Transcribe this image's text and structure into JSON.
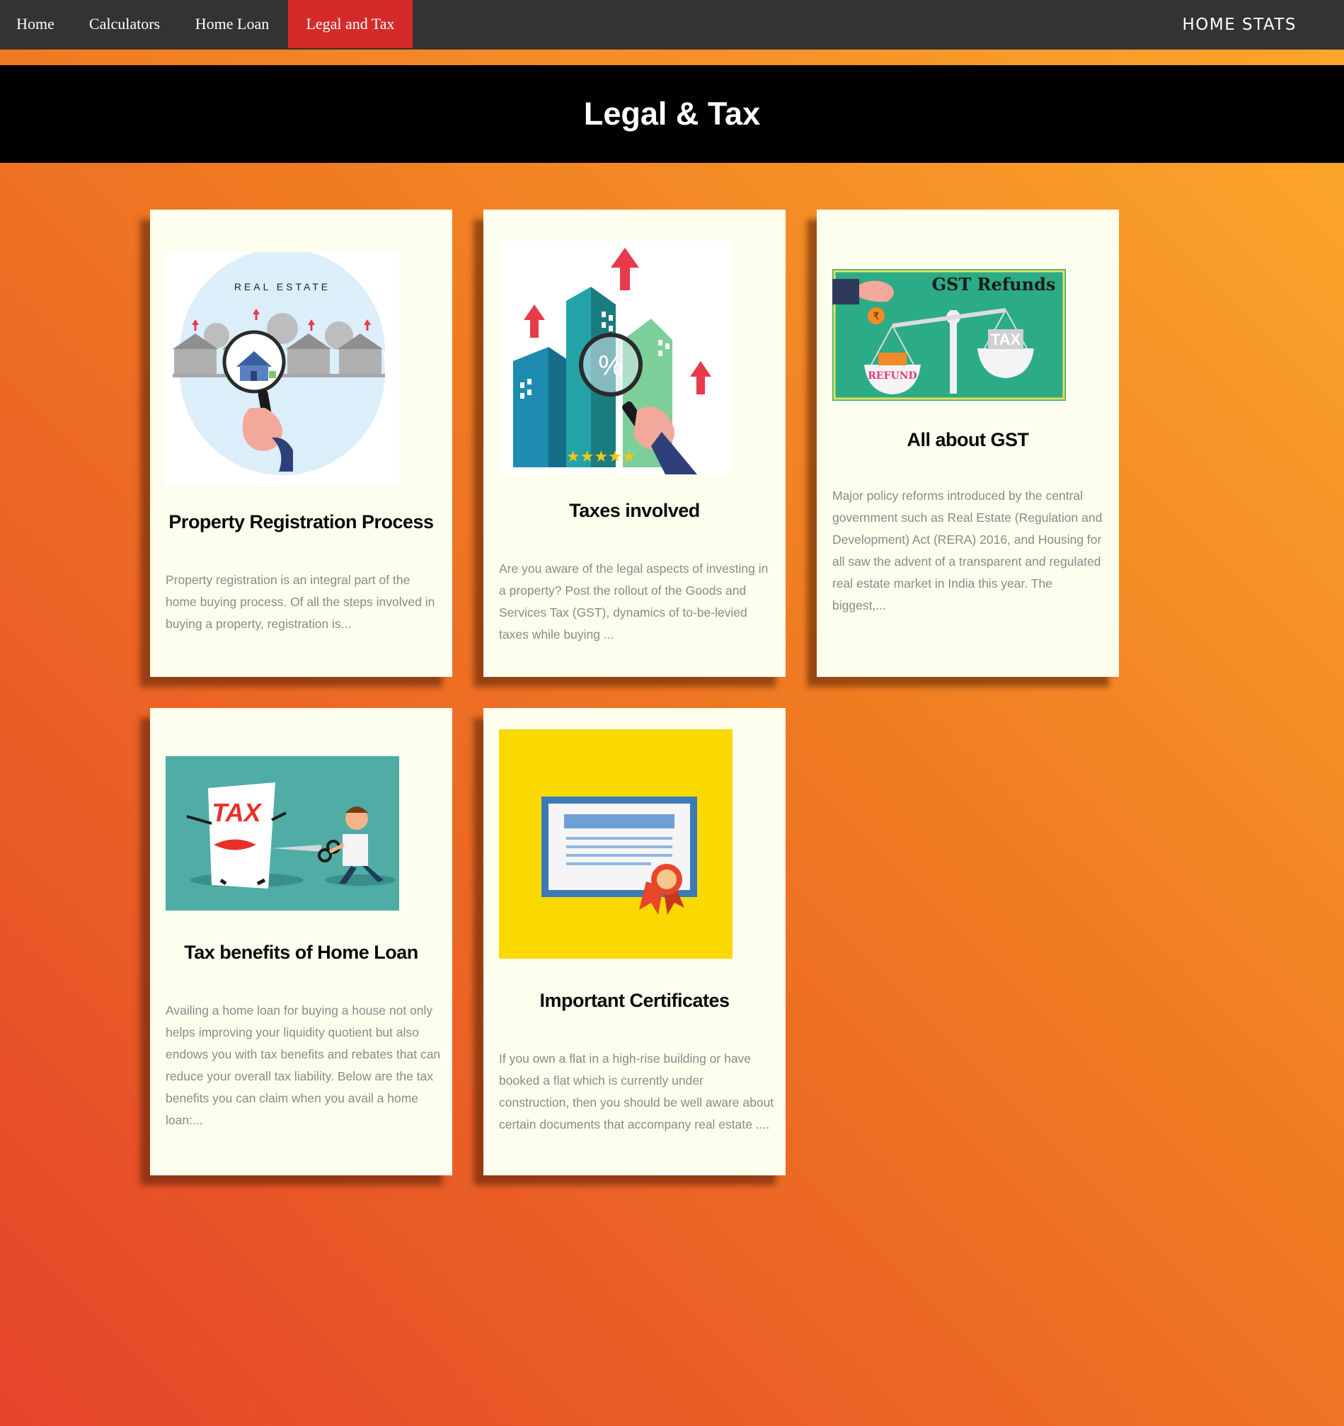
{
  "nav": {
    "items": [
      {
        "label": "Home"
      },
      {
        "label": "Calculators"
      },
      {
        "label": "Home Loan"
      },
      {
        "label": "Legal and Tax",
        "active": true
      }
    ],
    "brand": "HOME STATS"
  },
  "page": {
    "title": "Legal & Tax"
  },
  "cards": [
    {
      "title": "Property Registration Process",
      "excerpt": "Property registration is an integral part of the home buying process. Of all the steps involved in buying a property, registration is...",
      "image_text": "REAL ESTATE"
    },
    {
      "title": "Taxes involved",
      "excerpt": "Are you aware of the legal aspects of investing in a property? Post the rollout of the Goods and Services Tax (GST), dynamics of to-be-levied taxes while buying ...",
      "image_text": "%"
    },
    {
      "title": "All about GST",
      "excerpt": "Major policy reforms introduced by the central government such as Real Estate (Regulation and Development) Act (RERA) 2016, and Housing for all saw the advent of a transparent and regulated real estate market in India this year. The biggest,...",
      "image_text": "GST Refunds",
      "image_tax": "TAX",
      "image_refund": "REFUND"
    },
    {
      "title": "Tax benefits of Home Loan",
      "excerpt": "Availing a home loan for buying a house not only helps improving your liquidity quotient but also endows you with tax benefits and rebates that can reduce your overall tax liability. Below are the tax benefits you can claim when you avail a home loan:...",
      "image_text": "TAX"
    },
    {
      "title": "Important Certificates",
      "excerpt": "If you own a flat in a high-rise building or have booked a flat which is currently under construction, then you should be well aware about certain documents that accompany real estate ...."
    }
  ],
  "colors": {
    "nav_bg": "#333333",
    "nav_active": "#d42a2a",
    "card_bg": "#fefeee"
  }
}
